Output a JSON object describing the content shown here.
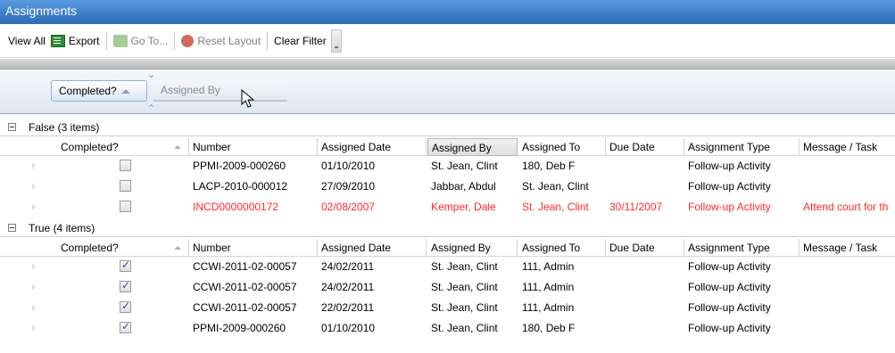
{
  "window": {
    "title": "Assignments"
  },
  "toolbar": {
    "view_all": "View All",
    "export": "Export",
    "go_to": "Go To...",
    "reset_layout": "Reset Layout",
    "clear_filter": "Clear Filter"
  },
  "group_panel": {
    "chips": [
      {
        "label": "Completed?"
      },
      {
        "label": "Assigned By"
      }
    ]
  },
  "columns": {
    "completed": "Completed?",
    "number": "Number",
    "assigned_date": "Assigned Date",
    "assigned_by": "Assigned By",
    "assigned_to": "Assigned To",
    "due_date": "Due Date",
    "assignment_type": "Assignment Type",
    "message_task": "Message / Task"
  },
  "groups": [
    {
      "label": "False (3 items)",
      "rows": [
        {
          "completed": false,
          "number": "PPMI-2009-000260",
          "assigned_date": "01/10/2010",
          "assigned_by": "St. Jean, Clint",
          "assigned_to": "180, Deb F",
          "due_date": "",
          "assignment_type": "Follow-up Activity",
          "message": "",
          "overdue": false
        },
        {
          "completed": false,
          "number": "LACP-2010-000012",
          "assigned_date": "27/09/2010",
          "assigned_by": "Jabbar, Abdul",
          "assigned_to": "St. Jean, Clint",
          "due_date": "",
          "assignment_type": "Follow-up Activity",
          "message": "",
          "overdue": false
        },
        {
          "completed": false,
          "number": "INCD0000000172",
          "assigned_date": "02/08/2007",
          "assigned_by": "Kemper, Dale",
          "assigned_to": "St. Jean, Clint",
          "due_date": "30/11/2007",
          "assignment_type": "Follow-up Activity",
          "message": "Attend court for th",
          "overdue": true
        }
      ]
    },
    {
      "label": "True (4 items)",
      "rows": [
        {
          "completed": true,
          "number": "CCWI-2011-02-00057",
          "assigned_date": "24/02/2011",
          "assigned_by": "St. Jean, Clint",
          "assigned_to": "111, Admin",
          "due_date": "",
          "assignment_type": "Follow-up Activity",
          "message": "",
          "overdue": false
        },
        {
          "completed": true,
          "number": "CCWI-2011-02-00057",
          "assigned_date": "24/02/2011",
          "assigned_by": "St. Jean, Clint",
          "assigned_to": "111, Admin",
          "due_date": "",
          "assignment_type": "Follow-up Activity",
          "message": "",
          "overdue": false
        },
        {
          "completed": true,
          "number": "CCWI-2011-02-00057",
          "assigned_date": "22/02/2011",
          "assigned_by": "St. Jean, Clint",
          "assigned_to": "111, Admin",
          "due_date": "",
          "assignment_type": "Follow-up Activity",
          "message": "",
          "overdue": false
        },
        {
          "completed": true,
          "number": "PPMI-2009-000260",
          "assigned_date": "01/10/2010",
          "assigned_by": "St. Jean, Clint",
          "assigned_to": "180, Deb F",
          "due_date": "",
          "assignment_type": "Follow-up Activity",
          "message": "",
          "overdue": false
        }
      ]
    }
  ],
  "colors": {
    "title_bar": "#3f7ec9",
    "overdue_text": "#ff2a2a",
    "group_chip_border": "#8fb0dc"
  },
  "icons": [
    "export-icon",
    "go-to-icon",
    "reset-layout-icon",
    "expand-chevron-icon",
    "collapse-chevron-icon",
    "mouse-cursor-icon",
    "collapse-group-icon",
    "sort-ascending-icon"
  ]
}
